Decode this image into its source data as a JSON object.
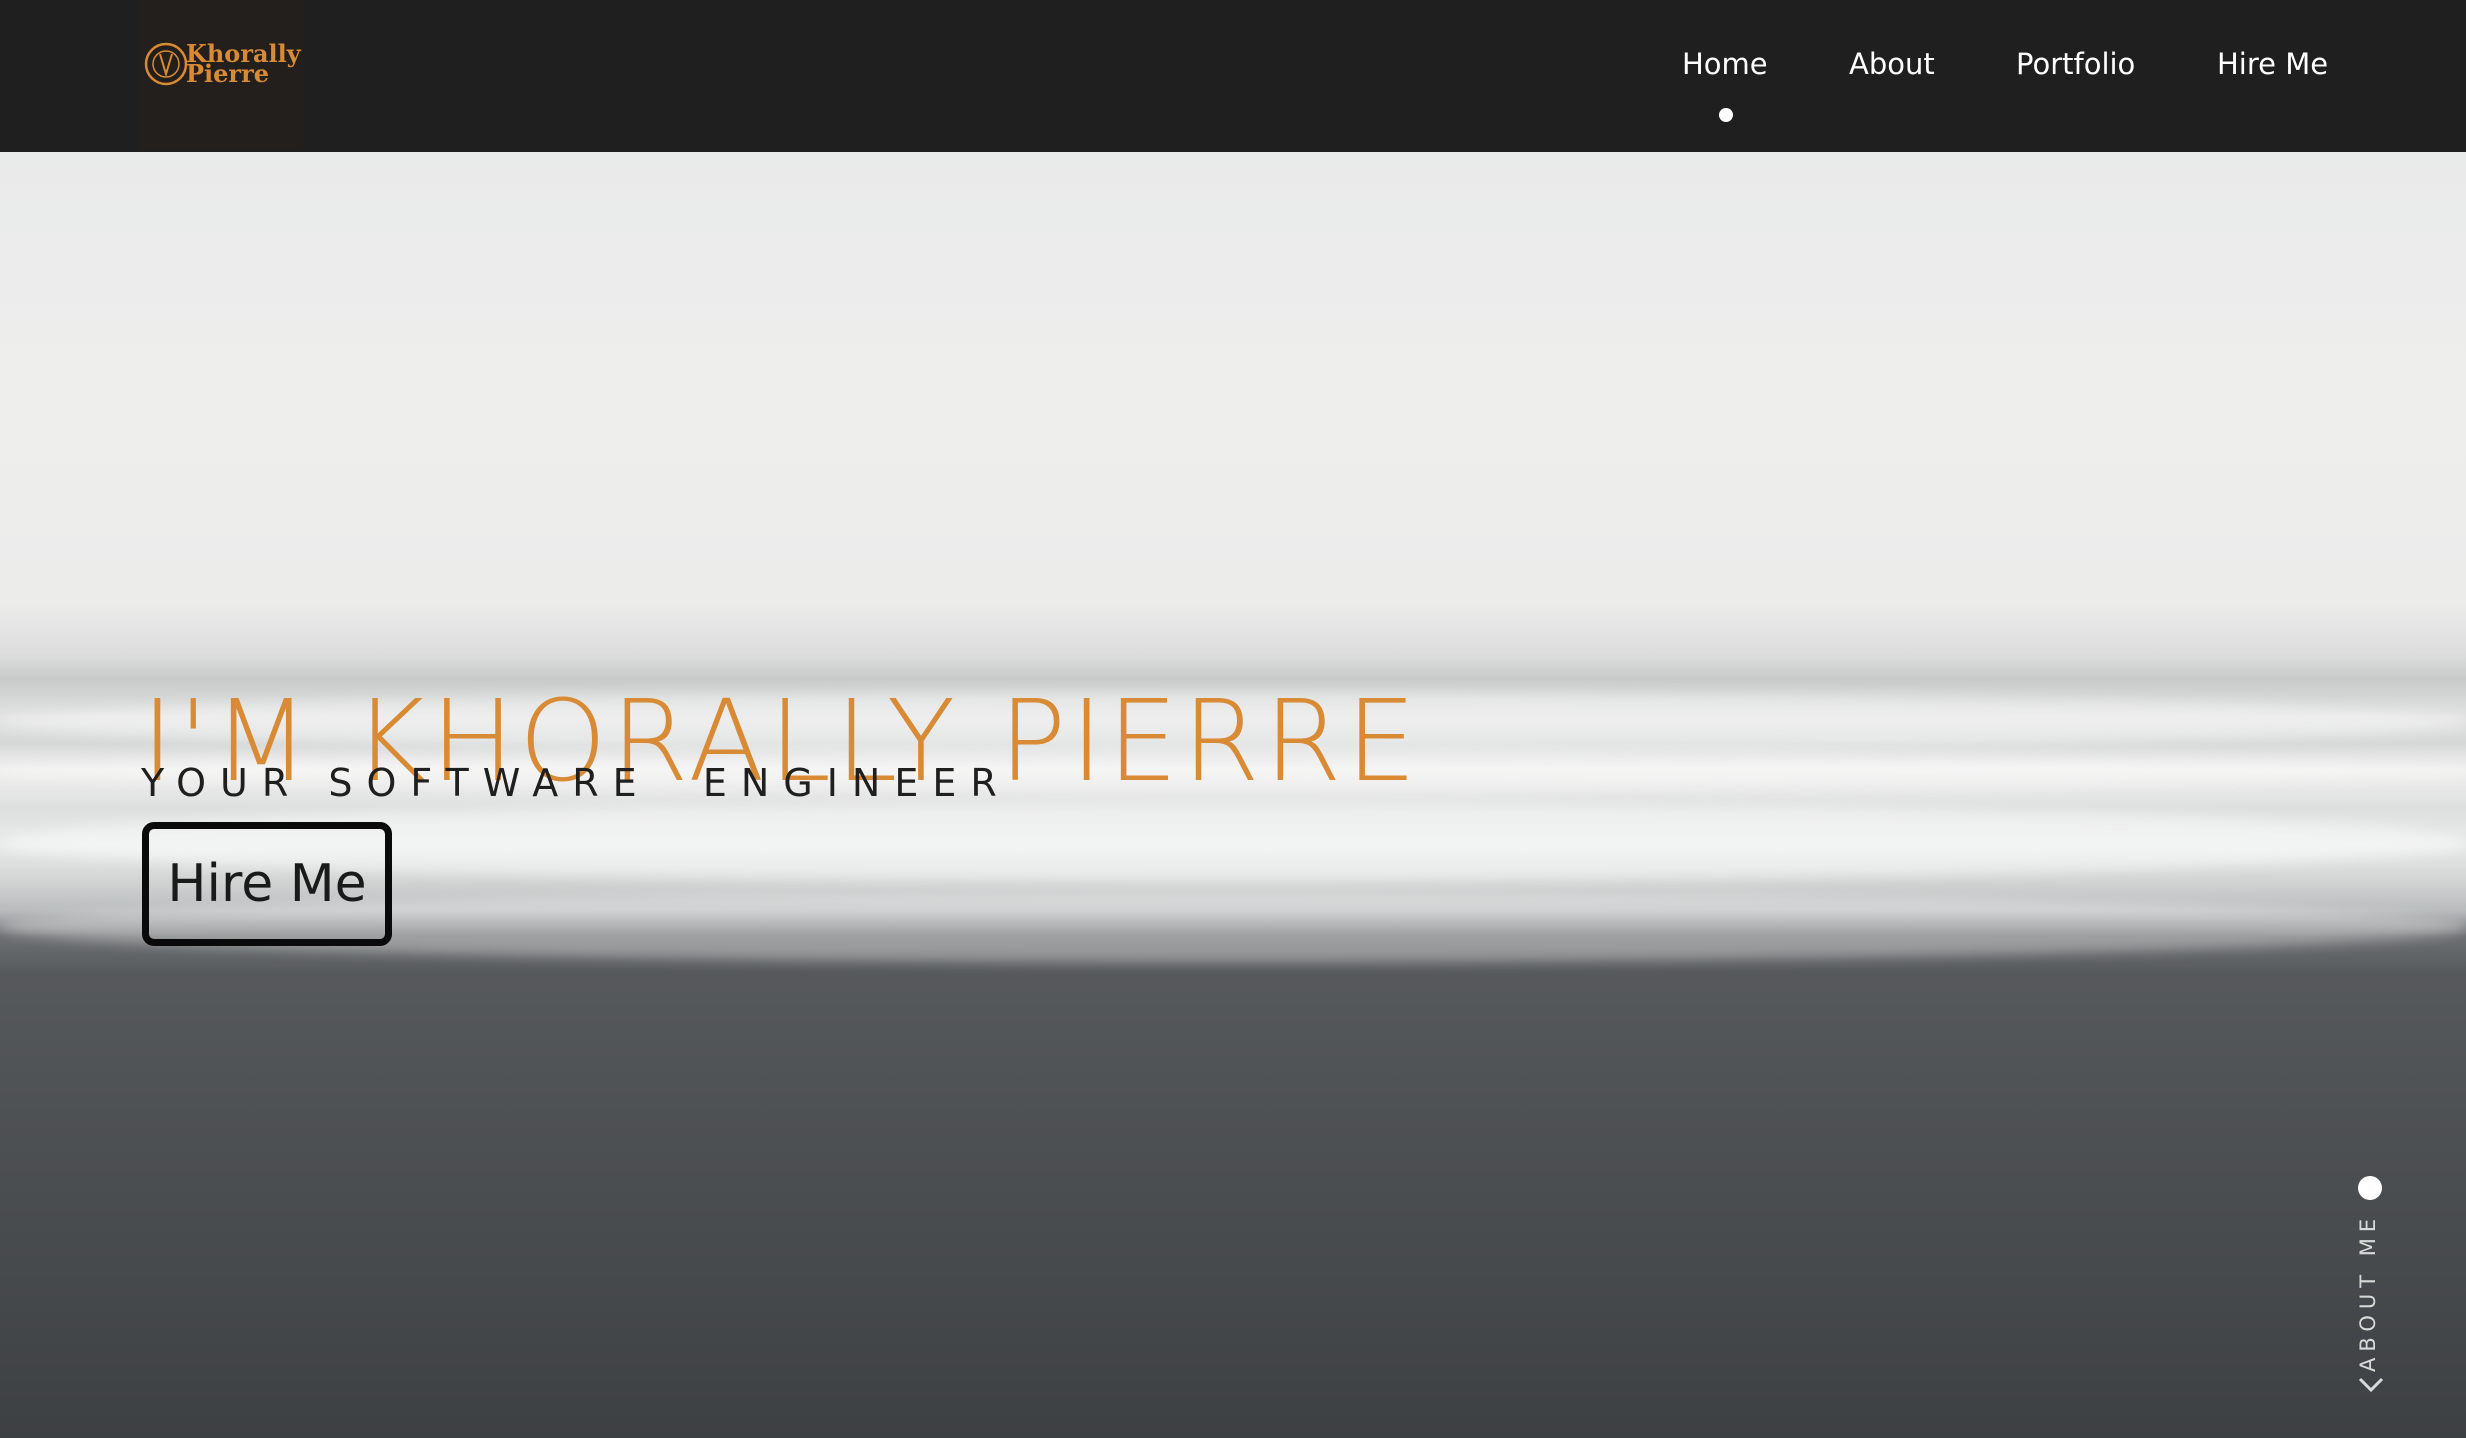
{
  "brand": {
    "logo_line1": "Khorally",
    "logo_line2": "Pierre",
    "accent_color": "#d98a34"
  },
  "nav": {
    "items": [
      {
        "label": "Home",
        "active": true
      },
      {
        "label": "About",
        "active": false
      },
      {
        "label": "Portfolio",
        "active": false
      },
      {
        "label": "Hire Me",
        "active": false
      }
    ]
  },
  "hero": {
    "title": "I'M KHORALLY PIERRE",
    "subtitle": "YOUR SOFTWARE  ENGINEER",
    "cta_label": "Hire Me",
    "background": "foggy-beach-waves-photo"
  },
  "side_scroll": {
    "label": "ABOUT ME",
    "icon": "circle-arrow-icon",
    "chevron": "chevron-down-icon"
  }
}
